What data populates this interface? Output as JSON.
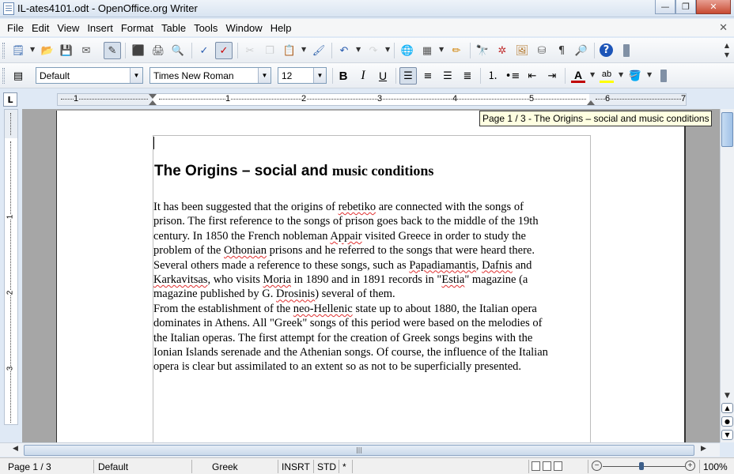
{
  "window": {
    "title": "IL-ates4101.odt - OpenOffice.org Writer",
    "minimize_glyph": "—",
    "maximize_glyph": "❐",
    "close_glyph": "✕"
  },
  "menu": {
    "items": [
      "File",
      "Edit",
      "View",
      "Insert",
      "Format",
      "Table",
      "Tools",
      "Window",
      "Help"
    ],
    "close_doc_glyph": "✕"
  },
  "toolbar": {
    "icons": [
      {
        "name": "new-document-icon",
        "glyph": "🗒",
        "color": "#3a6bb0"
      },
      {
        "name": "open-folder-icon",
        "glyph": "📂",
        "color": "#d9a000"
      },
      {
        "name": "save-icon",
        "glyph": "💾",
        "color": "#2f4f8f"
      },
      {
        "name": "send-email-icon",
        "glyph": "✉",
        "color": "#555"
      },
      {
        "name": "edit-file-icon",
        "glyph": "✎",
        "color": "#333"
      },
      {
        "name": "export-pdf-icon",
        "glyph": "⬛",
        "color": "#c33"
      },
      {
        "name": "print-icon",
        "glyph": "🖨",
        "color": "#444"
      },
      {
        "name": "page-preview-icon",
        "glyph": "🔍",
        "color": "#444"
      },
      {
        "name": "spellcheck-icon",
        "glyph": "✓",
        "color": "#2a5db0"
      },
      {
        "name": "auto-spellcheck-icon",
        "glyph": "✓",
        "color": "#c00"
      },
      {
        "name": "cut-icon",
        "glyph": "✂",
        "color": "#888"
      },
      {
        "name": "copy-icon",
        "glyph": "❐",
        "color": "#888"
      },
      {
        "name": "paste-icon",
        "glyph": "📋",
        "color": "#8a6a2a"
      },
      {
        "name": "clone-formatting-icon",
        "glyph": "🖌",
        "color": "#3a6bb0"
      },
      {
        "name": "undo-icon",
        "glyph": "↶",
        "color": "#2a5db0"
      },
      {
        "name": "redo-icon",
        "glyph": "↷",
        "color": "#999"
      },
      {
        "name": "hyperlink-icon",
        "glyph": "🌐",
        "color": "#2a7a2a"
      },
      {
        "name": "table-icon",
        "glyph": "▦",
        "color": "#555"
      },
      {
        "name": "show-draw-functions-icon",
        "glyph": "✏",
        "color": "#d08000"
      },
      {
        "name": "find-replace-icon",
        "glyph": "🔭",
        "color": "#333"
      },
      {
        "name": "navigator-icon",
        "glyph": "✲",
        "color": "#c03030"
      },
      {
        "name": "gallery-icon",
        "glyph": "🖼",
        "color": "#b07020"
      },
      {
        "name": "data-sources-icon",
        "glyph": "⛁",
        "color": "#666"
      },
      {
        "name": "formatting-marks-icon",
        "glyph": "¶",
        "color": "#333"
      },
      {
        "name": "zoom-icon",
        "glyph": "🔎",
        "color": "#333"
      },
      {
        "name": "help-icon",
        "glyph": "?",
        "color": "#1d55b8"
      }
    ]
  },
  "formatting": {
    "style_value": "Default",
    "font_value": "Times New Roman",
    "size_value": "12",
    "bold_label": "B",
    "italic_label": "I",
    "underline_label": "U",
    "font_color_label": "A",
    "highlight_label": "ab",
    "accent_font_color": "#c00000",
    "accent_highlight": "#ffff00"
  },
  "ruler": {
    "numbers": [
      "1",
      "1",
      "2",
      "3",
      "4",
      "5",
      "6",
      "7"
    ],
    "tab_selector": "L",
    "vertical_numbers": [
      "1",
      "2",
      "3"
    ]
  },
  "tooltip": {
    "text": "Page 1 / 3  -  The Origins – social and music conditions"
  },
  "document": {
    "heading_sans": "The Origins – social and ",
    "heading_serif": "music conditions",
    "body": {
      "l1a": "It has been suggested that the origins of ",
      "l1_sp": "rebetiko",
      "l1b": " are connected with the songs of",
      "l2": "prison. The first reference to the songs of prison goes back to the middle of the 19th",
      "l3a": "century. In 1850 the French nobleman ",
      "l3_sp": "Appair",
      "l3b": " visited Greece in order to study the",
      "l4a": "problem of the ",
      "l4_sp": "Othonian",
      "l4b": " prisons and he referred to the songs that were heard there.",
      "l5a": "Several others made a reference to these songs, such as ",
      "l5_sp1": "Papadiamantis",
      "l5b": ", ",
      "l5_sp2": "Dafnis",
      "l5c": " and",
      "l6_sp1": "Karkavitsas",
      "l6a": ", who visits ",
      "l6_sp2": "Moria",
      "l6b": " in 1890 and in 1891 records in \"",
      "l6_sp3": "Estia",
      "l6c": "\" magazine (a",
      "l7a": "magazine published by G. ",
      "l7_sp": "Drosinis",
      "l7b": ") several of them.",
      "l8a": "From the establishment of the ",
      "l8_sp": "neo-Hellenic",
      "l8b": " state up to about 1880, the Italian opera",
      "l9": "dominates in Athens. All \"Greek\" songs of this period were based on the melodies of",
      "l10": "the Italian operas. The first attempt for the creation of Greek songs begins with the",
      "l11": "Ionian Islands serenade and the Athenian songs. Of course, the influence of the Italian",
      "l12": "opera is clear but assimilated to an extent so as not to be superficially presented."
    }
  },
  "statusbar": {
    "page": "Page 1 / 3",
    "style": "Default",
    "language": "Greek",
    "insert_mode": "INSRT",
    "selection_mode": "STD",
    "modified": "*",
    "zoom": "100%",
    "zoom_level": 100
  }
}
